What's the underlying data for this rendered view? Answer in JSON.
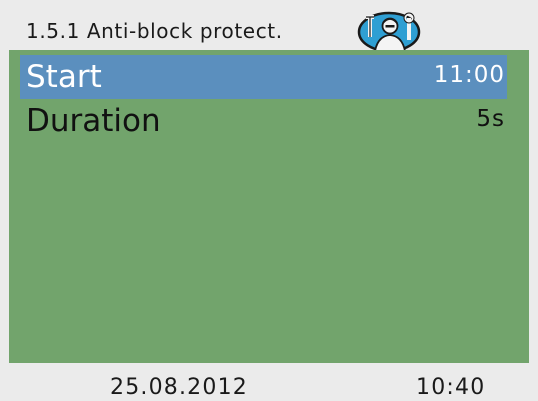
{
  "header": {
    "title": "1.5.1 Anti-block protect.",
    "icon": "service-technician-icon"
  },
  "menu": {
    "items": [
      {
        "label": "Start",
        "value": "11:00",
        "selected": true
      },
      {
        "label": "Duration",
        "value": "5s",
        "selected": false
      }
    ]
  },
  "footer": {
    "date": "25.08.2012",
    "time": "10:40"
  },
  "colors": {
    "background": "#ebebeb",
    "content": "#72a46c",
    "selection": "#5b8fbe",
    "icon_accent": "#2f9fd3"
  }
}
